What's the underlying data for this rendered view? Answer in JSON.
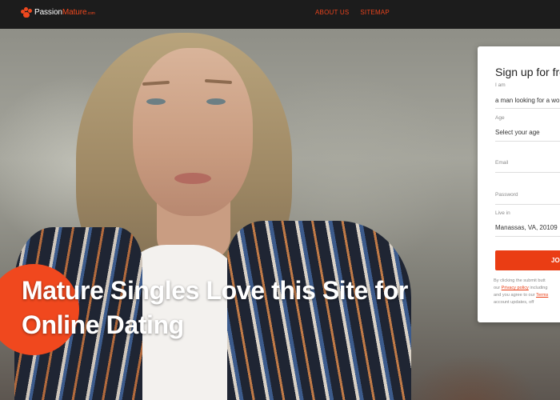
{
  "header": {
    "logo_part1": "Passion",
    "logo_part2": "Mature",
    "logo_suffix": ".com",
    "nav": [
      "ABOUT US",
      "SITEMAP"
    ]
  },
  "hero": {
    "headline": "Mature Singles Love this Site for Online Dating"
  },
  "signup": {
    "title": "Sign up for fre",
    "i_am_label": "I am",
    "i_am_value": "a man looking for a wo",
    "age_label": "Age",
    "age_value": "Select your age",
    "email_label": "Email",
    "password_label": "Password",
    "live_in_label": "Live in",
    "live_in_value": "Manassas, VA, 20109",
    "join_label": "JO",
    "legal_line1": "By clicking the submit butt",
    "legal_line2_pre": "our ",
    "legal_line2_link": "Privacy policy",
    "legal_line2_post": " including",
    "legal_line3_pre": "and you agree to our ",
    "legal_line3_link": "Terms",
    "legal_line4": "account updates, off"
  },
  "colors": {
    "accent": "#f0481e",
    "nav_link": "#e8431c",
    "topbar": "#1c1c1c"
  }
}
